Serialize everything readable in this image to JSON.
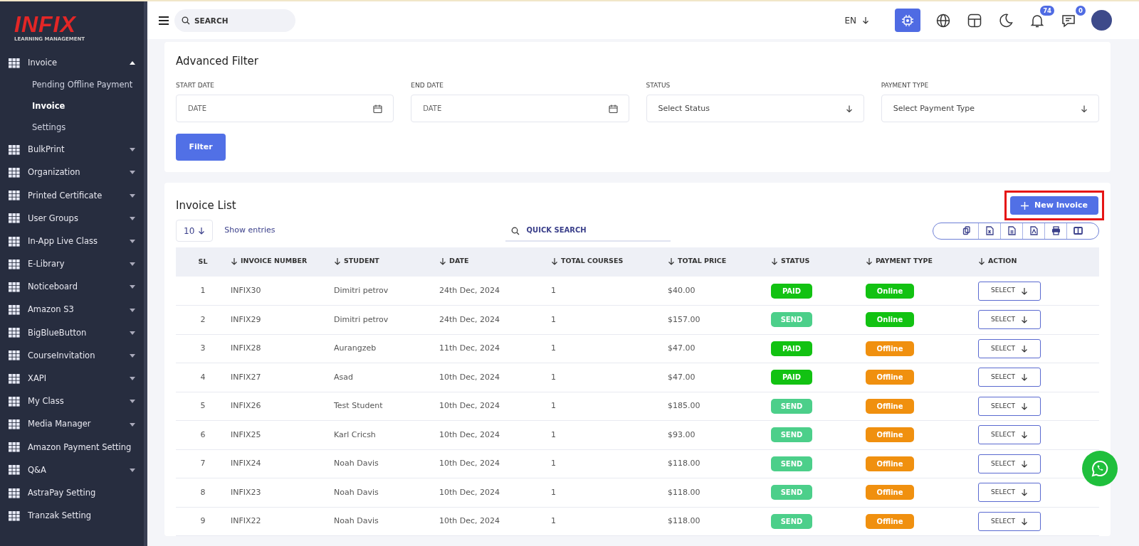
{
  "brand": {
    "logo": "INFIX",
    "tagline": "LEARNING MANAGEMENT"
  },
  "sidebar": {
    "items": [
      {
        "label": "Invoice",
        "expanded": true,
        "children": [
          {
            "label": "Pending Offline Payment",
            "selected": false
          },
          {
            "label": "Invoice",
            "selected": true
          },
          {
            "label": "Settings",
            "selected": false
          }
        ]
      },
      {
        "label": "BulkPrint",
        "expanded": false
      },
      {
        "label": "Organization",
        "expanded": false
      },
      {
        "label": "Printed Certificate",
        "expanded": false
      },
      {
        "label": "User Groups",
        "expanded": false
      },
      {
        "label": "In-App Live Class",
        "expanded": false
      },
      {
        "label": "E-Library",
        "expanded": false
      },
      {
        "label": "Noticeboard",
        "expanded": false
      },
      {
        "label": "Amazon S3",
        "expanded": false
      },
      {
        "label": "BigBlueButton",
        "expanded": false
      },
      {
        "label": "CourseInvitation",
        "expanded": false
      },
      {
        "label": "XAPI",
        "expanded": false
      },
      {
        "label": "My Class",
        "expanded": false
      },
      {
        "label": "Media Manager",
        "expanded": false
      },
      {
        "label": "Amazon Payment Setting"
      },
      {
        "label": "Q&A",
        "expanded": false
      },
      {
        "label": "AstraPay Setting"
      },
      {
        "label": "Tranzak Setting"
      }
    ]
  },
  "topbar": {
    "search_placeholder": "SEARCH",
    "language": "EN",
    "notifications": "74",
    "messages": "0"
  },
  "filter": {
    "title": "Advanced Filter",
    "fields": [
      {
        "label": "START DATE",
        "kind": "date",
        "placeholder": "DATE"
      },
      {
        "label": "END DATE",
        "kind": "date",
        "placeholder": "DATE"
      },
      {
        "label": "STATUS",
        "kind": "select",
        "placeholder": "Select Status"
      },
      {
        "label": "PAYMENT TYPE",
        "kind": "select",
        "placeholder": "Select Payment Type"
      }
    ],
    "button": "Filter"
  },
  "invoice_list": {
    "title": "Invoice List",
    "new_button": {
      "label": "New Invoice",
      "highlighted": true
    },
    "entries": "10",
    "entries_label": "Show entries",
    "search_placeholder": "QUICK SEARCH",
    "columns": [
      "SL",
      "INVOICE NUMBER",
      "STUDENT",
      "DATE",
      "TOTAL COURSES",
      "TOTAL PRICE",
      "STATUS",
      "PAYMENT TYPE",
      "ACTION"
    ],
    "rows": [
      {
        "sl": "1",
        "number": "INFIX30",
        "student": "Dimitri petrov",
        "date": "24th Dec, 2024",
        "courses": "1",
        "price": "$40.00",
        "status": {
          "label": "PAID",
          "color": "#12c212"
        },
        "payment": {
          "label": "Online",
          "color": "#12c212"
        },
        "action": "SELECT"
      },
      {
        "sl": "2",
        "number": "INFIX29",
        "student": "Dimitri petrov",
        "date": "24th Dec, 2024",
        "courses": "1",
        "price": "$157.00",
        "status": {
          "label": "SEND",
          "color": "#4ccf8a"
        },
        "payment": {
          "label": "Online",
          "color": "#12c212"
        },
        "action": "SELECT"
      },
      {
        "sl": "3",
        "number": "INFIX28",
        "student": "Aurangzeb",
        "date": "11th Dec, 2024",
        "courses": "1",
        "price": "$47.00",
        "status": {
          "label": "PAID",
          "color": "#12c212"
        },
        "payment": {
          "label": "Offline",
          "color": "#f0900f"
        },
        "action": "SELECT"
      },
      {
        "sl": "4",
        "number": "INFIX27",
        "student": "Asad",
        "date": "10th Dec, 2024",
        "courses": "1",
        "price": "$47.00",
        "status": {
          "label": "PAID",
          "color": "#12c212"
        },
        "payment": {
          "label": "Offline",
          "color": "#f0900f"
        },
        "action": "SELECT"
      },
      {
        "sl": "5",
        "number": "INFIX26",
        "student": "Test Student",
        "date": "10th Dec, 2024",
        "courses": "1",
        "price": "$185.00",
        "status": {
          "label": "SEND",
          "color": "#4ccf8a"
        },
        "payment": {
          "label": "Offline",
          "color": "#f0900f"
        },
        "action": "SELECT"
      },
      {
        "sl": "6",
        "number": "INFIX25",
        "student": "Karl Cricsh",
        "date": "10th Dec, 2024",
        "courses": "1",
        "price": "$93.00",
        "status": {
          "label": "SEND",
          "color": "#4ccf8a"
        },
        "payment": {
          "label": "Offline",
          "color": "#f0900f"
        },
        "action": "SELECT"
      },
      {
        "sl": "7",
        "number": "INFIX24",
        "student": "Noah Davis",
        "date": "10th Dec, 2024",
        "courses": "1",
        "price": "$118.00",
        "status": {
          "label": "SEND",
          "color": "#4ccf8a"
        },
        "payment": {
          "label": "Offline",
          "color": "#f0900f"
        },
        "action": "SELECT"
      },
      {
        "sl": "8",
        "number": "INFIX23",
        "student": "Noah Davis",
        "date": "10th Dec, 2024",
        "courses": "1",
        "price": "$118.00",
        "status": {
          "label": "SEND",
          "color": "#4ccf8a"
        },
        "payment": {
          "label": "Offline",
          "color": "#f0900f"
        },
        "action": "SELECT"
      },
      {
        "sl": "9",
        "number": "INFIX22",
        "student": "Noah Davis",
        "date": "10th Dec, 2024",
        "courses": "1",
        "price": "$118.00",
        "status": {
          "label": "SEND",
          "color": "#4ccf8a"
        },
        "payment": {
          "label": "Offline",
          "color": "#f0900f"
        },
        "action": "SELECT"
      }
    ]
  }
}
